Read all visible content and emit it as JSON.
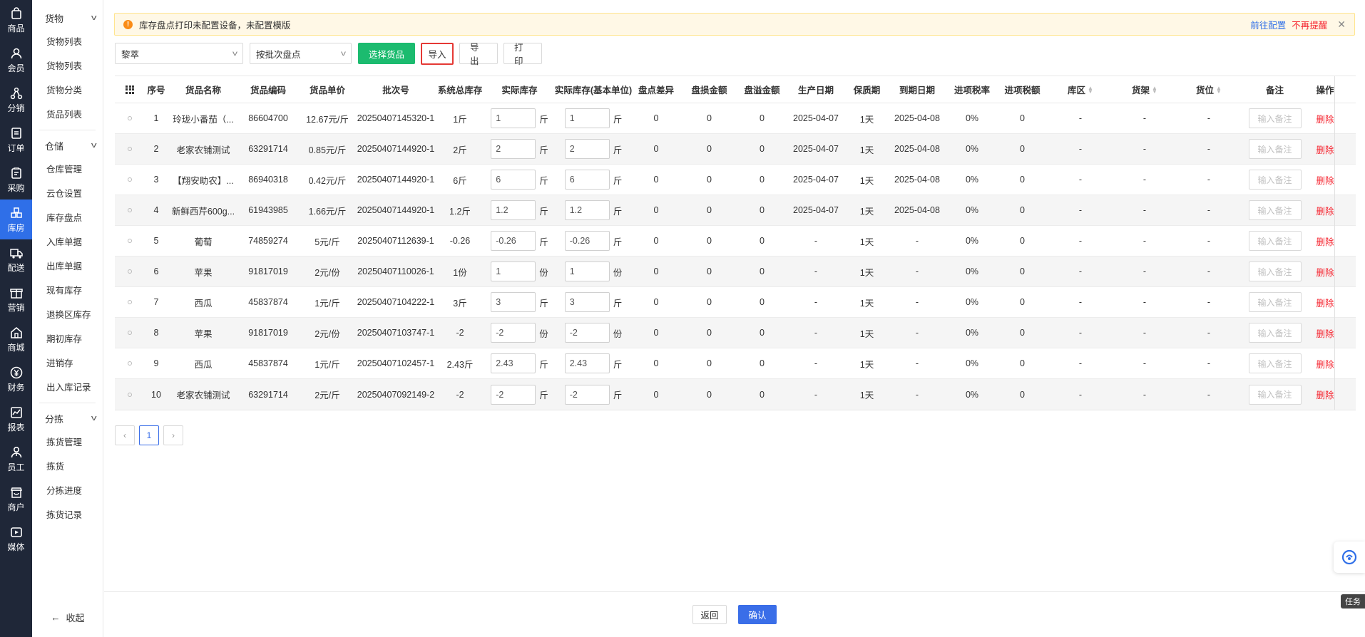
{
  "nav": {
    "items": [
      {
        "label": "商品",
        "icon": "bag-icon"
      },
      {
        "label": "会员",
        "icon": "user-icon"
      },
      {
        "label": "分销",
        "icon": "share-icon"
      },
      {
        "label": "订单",
        "icon": "order-icon"
      },
      {
        "label": "采购",
        "icon": "purchase-icon"
      },
      {
        "label": "库房",
        "icon": "warehouse-icon"
      },
      {
        "label": "配送",
        "icon": "truck-icon"
      },
      {
        "label": "营销",
        "icon": "gift-icon"
      },
      {
        "label": "商城",
        "icon": "store-icon"
      },
      {
        "label": "财务",
        "icon": "yen-icon"
      },
      {
        "label": "报表",
        "icon": "chart-icon"
      },
      {
        "label": "员工",
        "icon": "staff-icon"
      },
      {
        "label": "商户",
        "icon": "merchant-icon"
      },
      {
        "label": "媒体",
        "icon": "media-icon"
      }
    ],
    "active_index": 5,
    "active_color": "#2f6fe8"
  },
  "submenu": {
    "groups": [
      {
        "label": "货物",
        "items": [
          "货物列表",
          "货物列表",
          "货物分类",
          "货品列表"
        ]
      },
      {
        "label": "仓储",
        "items": [
          "仓库管理",
          "云仓设置",
          "库存盘点",
          "入库单据",
          "出库单据",
          "现有库存",
          "退换区库存",
          "期初库存",
          "进销存",
          "出入库记录"
        ]
      },
      {
        "label": "分拣",
        "items": [
          "拣货管理",
          "拣货",
          "分拣进度",
          "拣货记录"
        ]
      }
    ],
    "collapse_label": "收起"
  },
  "notice": {
    "text": "库存盘点打印未配置设备，未配置模版",
    "configure_link": "前往配置",
    "dismiss_link": "不再提醒"
  },
  "toolbar": {
    "warehouse_select": "黎萃",
    "mode_select": "按批次盘点",
    "select_goods": "选择货品",
    "import": "导入",
    "export": "导出",
    "print": "打印"
  },
  "table": {
    "headers": {
      "index": "序号",
      "name": "货品名称",
      "code": "货品编码",
      "price": "货品单价",
      "batch": "批次号",
      "system_stock": "系统总库存",
      "actual_stock": "实际库存",
      "actual_base": "实际库存(基本单位)",
      "diff": "盘点差异",
      "loss": "盘损金额",
      "gain": "盘溢金额",
      "prod_date": "生产日期",
      "shelf_life": "保质期",
      "expire_date": "到期日期",
      "tax_rate": "进项税率",
      "tax_amount": "进项税额",
      "area": "库区",
      "shelf": "货架",
      "slot": "货位",
      "remark": "备注",
      "op": "操作"
    },
    "remark_placeholder": "输入备注",
    "delete_label": "删除",
    "rows": [
      {
        "index": "1",
        "name": "玲珑小番茄（...",
        "code": "86604700",
        "price": "12.67元/斤",
        "batch": "20250407145320-1",
        "system_stock": "1斤",
        "actual": "1",
        "unit": "斤",
        "actual_base": "1",
        "base_unit": "斤",
        "diff": "0",
        "loss": "0",
        "gain": "0",
        "prod_date": "2025-04-07",
        "shelf_life": "1天",
        "expire_date": "2025-04-08",
        "tax_rate": "0%",
        "tax_amount": "0",
        "area": "-",
        "shelf": "-",
        "slot": "-"
      },
      {
        "index": "2",
        "name": "老家农铺测试",
        "code": "63291714",
        "price": "0.85元/斤",
        "batch": "20250407144920-1",
        "system_stock": "2斤",
        "actual": "2",
        "unit": "斤",
        "actual_base": "2",
        "base_unit": "斤",
        "diff": "0",
        "loss": "0",
        "gain": "0",
        "prod_date": "2025-04-07",
        "shelf_life": "1天",
        "expire_date": "2025-04-08",
        "tax_rate": "0%",
        "tax_amount": "0",
        "area": "-",
        "shelf": "-",
        "slot": "-"
      },
      {
        "index": "3",
        "name": "【翔安助农】...",
        "code": "86940318",
        "price": "0.42元/斤",
        "batch": "20250407144920-1",
        "system_stock": "6斤",
        "actual": "6",
        "unit": "斤",
        "actual_base": "6",
        "base_unit": "斤",
        "diff": "0",
        "loss": "0",
        "gain": "0",
        "prod_date": "2025-04-07",
        "shelf_life": "1天",
        "expire_date": "2025-04-08",
        "tax_rate": "0%",
        "tax_amount": "0",
        "area": "-",
        "shelf": "-",
        "slot": "-"
      },
      {
        "index": "4",
        "name": "新鲜西芹600g...",
        "code": "61943985",
        "price": "1.66元/斤",
        "batch": "20250407144920-1",
        "system_stock": "1.2斤",
        "actual": "1.2",
        "unit": "斤",
        "actual_base": "1.2",
        "base_unit": "斤",
        "diff": "0",
        "loss": "0",
        "gain": "0",
        "prod_date": "2025-04-07",
        "shelf_life": "1天",
        "expire_date": "2025-04-08",
        "tax_rate": "0%",
        "tax_amount": "0",
        "area": "-",
        "shelf": "-",
        "slot": "-"
      },
      {
        "index": "5",
        "name": "葡萄",
        "code": "74859274",
        "price": "5元/斤",
        "batch": "20250407112639-1",
        "system_stock": "-0.26",
        "actual": "-0.26",
        "unit": "斤",
        "actual_base": "-0.26",
        "base_unit": "斤",
        "diff": "0",
        "loss": "0",
        "gain": "0",
        "prod_date": "-",
        "shelf_life": "1天",
        "expire_date": "-",
        "tax_rate": "0%",
        "tax_amount": "0",
        "area": "-",
        "shelf": "-",
        "slot": "-"
      },
      {
        "index": "6",
        "name": "苹果",
        "code": "91817019",
        "price": "2元/份",
        "batch": "20250407110026-1",
        "system_stock": "1份",
        "actual": "1",
        "unit": "份",
        "actual_base": "1",
        "base_unit": "份",
        "diff": "0",
        "loss": "0",
        "gain": "0",
        "prod_date": "-",
        "shelf_life": "1天",
        "expire_date": "-",
        "tax_rate": "0%",
        "tax_amount": "0",
        "area": "-",
        "shelf": "-",
        "slot": "-"
      },
      {
        "index": "7",
        "name": "西瓜",
        "code": "45837874",
        "price": "1元/斤",
        "batch": "20250407104222-1",
        "system_stock": "3斤",
        "actual": "3",
        "unit": "斤",
        "actual_base": "3",
        "base_unit": "斤",
        "diff": "0",
        "loss": "0",
        "gain": "0",
        "prod_date": "-",
        "shelf_life": "1天",
        "expire_date": "-",
        "tax_rate": "0%",
        "tax_amount": "0",
        "area": "-",
        "shelf": "-",
        "slot": "-"
      },
      {
        "index": "8",
        "name": "苹果",
        "code": "91817019",
        "price": "2元/份",
        "batch": "20250407103747-1",
        "system_stock": "-2",
        "actual": "-2",
        "unit": "份",
        "actual_base": "-2",
        "base_unit": "份",
        "diff": "0",
        "loss": "0",
        "gain": "0",
        "prod_date": "-",
        "shelf_life": "1天",
        "expire_date": "-",
        "tax_rate": "0%",
        "tax_amount": "0",
        "area": "-",
        "shelf": "-",
        "slot": "-"
      },
      {
        "index": "9",
        "name": "西瓜",
        "code": "45837874",
        "price": "1元/斤",
        "batch": "20250407102457-1",
        "system_stock": "2.43斤",
        "actual": "2.43",
        "unit": "斤",
        "actual_base": "2.43",
        "base_unit": "斤",
        "diff": "0",
        "loss": "0",
        "gain": "0",
        "prod_date": "-",
        "shelf_life": "1天",
        "expire_date": "-",
        "tax_rate": "0%",
        "tax_amount": "0",
        "area": "-",
        "shelf": "-",
        "slot": "-"
      },
      {
        "index": "10",
        "name": "老家农铺测试",
        "code": "63291714",
        "price": "2元/斤",
        "batch": "20250407092149-2",
        "system_stock": "-2",
        "actual": "-2",
        "unit": "斤",
        "actual_base": "-2",
        "base_unit": "斤",
        "diff": "0",
        "loss": "0",
        "gain": "0",
        "prod_date": "-",
        "shelf_life": "1天",
        "expire_date": "-",
        "tax_rate": "0%",
        "tax_amount": "0",
        "area": "-",
        "shelf": "-",
        "slot": "-"
      }
    ]
  },
  "pager": {
    "prev": "‹",
    "current": "1",
    "next": "›"
  },
  "footer": {
    "back": "返回",
    "confirm": "确认"
  },
  "side_tag": "任务"
}
